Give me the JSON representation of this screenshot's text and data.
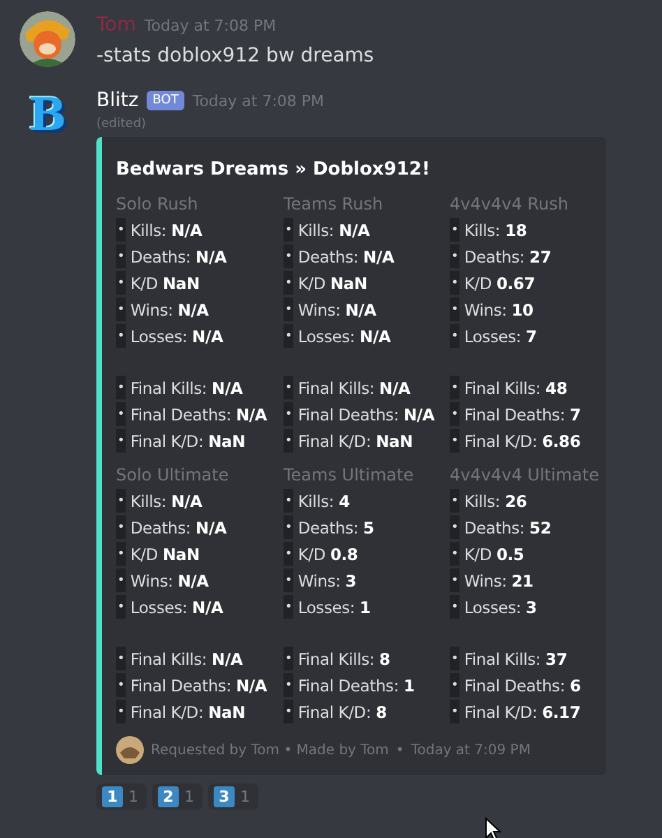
{
  "messages": [
    {
      "author": "Tom",
      "color": "#8e2a44",
      "timestamp": "Today at 7:08 PM",
      "kind": "user",
      "text": "-stats doblox912 bw dreams"
    },
    {
      "author": "Blitz",
      "color": "#ffffff",
      "badge": "BOT",
      "timestamp": "Today at 7:08 PM",
      "kind": "bot",
      "avatar_letter": "B",
      "edited": "(edited)",
      "embed": {
        "color": "#4fe0c6",
        "title": "Bedwars Dreams » Doblox912!",
        "fields": [
          {
            "name": "Solo Rush",
            "stats": [
              {
                "bullet": "•",
                "label": "Kills:",
                "value": "N/A"
              },
              {
                "bullet": "•",
                "label": "Deaths:",
                "value": "N/A"
              },
              {
                "bullet": "•",
                "label": "K/D",
                "value": "NaN"
              },
              {
                "bullet": "•",
                "label": "Wins:",
                "value": "N/A"
              },
              {
                "bullet": "•",
                "label": "Losses:",
                "value": "N/A"
              }
            ],
            "finals": [
              {
                "bullet": "•",
                "label": "Final Kills:",
                "value": "N/A"
              },
              {
                "bullet": "•",
                "label": "Final Deaths:",
                "value": "N/A"
              },
              {
                "bullet": "•",
                "label": "Final K/D:",
                "value": "NaN"
              }
            ]
          },
          {
            "name": "Teams Rush",
            "stats": [
              {
                "bullet": "•",
                "label": "Kills:",
                "value": "N/A"
              },
              {
                "bullet": "•",
                "label": "Deaths:",
                "value": "N/A"
              },
              {
                "bullet": "•",
                "label": "K/D",
                "value": "NaN"
              },
              {
                "bullet": "•",
                "label": "Wins:",
                "value": "N/A"
              },
              {
                "bullet": "•",
                "label": "Losses:",
                "value": "N/A"
              }
            ],
            "finals": [
              {
                "bullet": "•",
                "label": "Final Kills:",
                "value": "N/A"
              },
              {
                "bullet": "•",
                "label": "Final Deaths:",
                "value": "N/A"
              },
              {
                "bullet": "•",
                "label": "Final K/D:",
                "value": "NaN"
              }
            ]
          },
          {
            "name": "4v4v4v4 Rush",
            "stats": [
              {
                "bullet": "•",
                "label": "Kills:",
                "value": "18"
              },
              {
                "bullet": "•",
                "label": "Deaths:",
                "value": "27"
              },
              {
                "bullet": "•",
                "label": "K/D",
                "value": "0.67"
              },
              {
                "bullet": "•",
                "label": "Wins:",
                "value": "10"
              },
              {
                "bullet": "•",
                "label": "Losses:",
                "value": "7"
              }
            ],
            "finals": [
              {
                "bullet": "•",
                "label": "Final Kills:",
                "value": "48"
              },
              {
                "bullet": "•",
                "label": "Final Deaths:",
                "value": "7"
              },
              {
                "bullet": "•",
                "label": "Final K/D:",
                "value": "6.86"
              }
            ]
          },
          {
            "name": "Solo Ultimate",
            "stats": [
              {
                "bullet": "•",
                "label": "Kills:",
                "value": "N/A"
              },
              {
                "bullet": "•",
                "label": "Deaths:",
                "value": "N/A"
              },
              {
                "bullet": "•",
                "label": "K/D",
                "value": "NaN"
              },
              {
                "bullet": "•",
                "label": "Wins:",
                "value": "N/A"
              },
              {
                "bullet": "•",
                "label": "Losses:",
                "value": "N/A"
              }
            ],
            "finals": [
              {
                "bullet": "•",
                "label": "Final Kills:",
                "value": "N/A"
              },
              {
                "bullet": "•",
                "label": "Final Deaths:",
                "value": "N/A"
              },
              {
                "bullet": "•",
                "label": "Final K/D:",
                "value": "NaN"
              }
            ]
          },
          {
            "name": "Teams Ultimate",
            "stats": [
              {
                "bullet": "•",
                "label": "Kills:",
                "value": "4"
              },
              {
                "bullet": "•",
                "label": "Deaths:",
                "value": "5"
              },
              {
                "bullet": "•",
                "label": "K/D",
                "value": "0.8"
              },
              {
                "bullet": "•",
                "label": "Wins:",
                "value": "3"
              },
              {
                "bullet": "•",
                "label": "Losses:",
                "value": "1"
              }
            ],
            "finals": [
              {
                "bullet": "•",
                "label": "Final Kills:",
                "value": "8"
              },
              {
                "bullet": "•",
                "label": "Final Deaths:",
                "value": "1"
              },
              {
                "bullet": "•",
                "label": "Final K/D:",
                "value": "8"
              }
            ]
          },
          {
            "name": "4v4v4v4 Ultimate",
            "stats": [
              {
                "bullet": "•",
                "label": "Kills:",
                "value": "26"
              },
              {
                "bullet": "•",
                "label": "Deaths:",
                "value": "52"
              },
              {
                "bullet": "•",
                "label": "K/D",
                "value": "0.5"
              },
              {
                "bullet": "•",
                "label": "Wins:",
                "value": "21"
              },
              {
                "bullet": "•",
                "label": "Losses:",
                "value": "3"
              }
            ],
            "finals": [
              {
                "bullet": "•",
                "label": "Final Kills:",
                "value": "37"
              },
              {
                "bullet": "•",
                "label": "Final Deaths:",
                "value": "6"
              },
              {
                "bullet": "•",
                "label": "Final K/D:",
                "value": "6.17"
              }
            ]
          }
        ],
        "footer": {
          "text": "Requested by Tom • Made by Tom",
          "separator": "•",
          "timestamp": "Today at 7:09 PM"
        }
      },
      "reactions": [
        {
          "emoji": "1",
          "count": "1"
        },
        {
          "emoji": "2",
          "count": "1"
        },
        {
          "emoji": "3",
          "count": "1"
        }
      ]
    }
  ]
}
